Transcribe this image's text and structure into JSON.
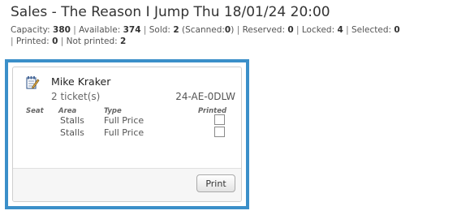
{
  "page": {
    "title": "Sales - The Reason I Jump Thu 18/01/24 20:00"
  },
  "stats": {
    "capacity_label": "Capacity:",
    "capacity": "380",
    "available_label": "Available:",
    "available": "374",
    "sold_label": "Sold:",
    "sold": "2",
    "scanned_label": "(Scanned:",
    "scanned": "0",
    "scanned_close": ")",
    "reserved_label": "Reserved:",
    "reserved": "0",
    "locked_label": "Locked:",
    "locked": "4",
    "selected_label": "Selected:",
    "selected": "0",
    "printed_label": "Printed:",
    "printed": "0",
    "not_printed_label": "Not printed:",
    "not_printed": "2",
    "separator": "|"
  },
  "order": {
    "customer_name": "Mike Kraker",
    "tickets": "2 ticket(s)",
    "reference": "24-AE-0DLW",
    "headers": {
      "seat": "Seat",
      "area": "Area",
      "type": "Type",
      "printed": "Printed"
    },
    "rows": [
      {
        "seat": "",
        "area": "Stalls",
        "type": "Full Price",
        "printed": false
      },
      {
        "seat": "",
        "area": "Stalls",
        "type": "Full Price",
        "printed": false
      }
    ],
    "print_button": "Print",
    "icons": {
      "edit": "edit-note-icon"
    },
    "colors": {
      "selected_border": "#3b8fc9"
    }
  }
}
